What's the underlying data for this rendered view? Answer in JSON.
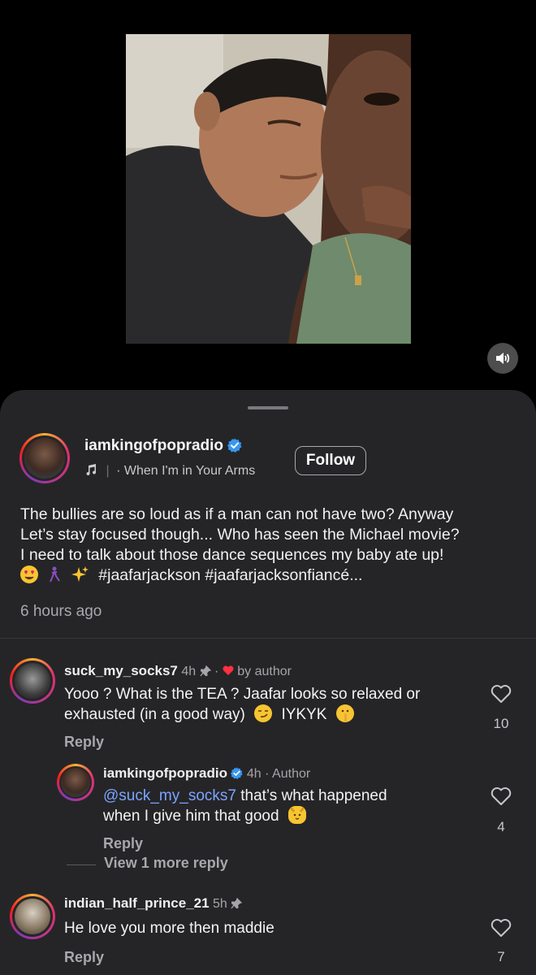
{
  "post": {
    "username": "iamkingofpopradio",
    "music_title": "When I'm in Your Arms",
    "follow_label": "Follow",
    "caption_lines": [
      "The bullies are so loud as if a man can not have two? Anyway",
      "Let’s stay focused though... Who has seen the Michael movie?",
      "I need to talk about those dance sequences my baby ate up!"
    ],
    "caption_tags": "#jaafarjackson #jaafarjacksonfiancé...",
    "time_ago": "6 hours ago"
  },
  "comments": [
    {
      "username": "suck_my_socks7",
      "time": "4h",
      "separator": "·",
      "author_like": "by author",
      "text_line1": "Yooo ? What is the TEA ? Jaafar looks so relaxed or",
      "text_line2_a": "exhausted (in a good way)",
      "text_line2_b": "IYKYK",
      "reply_label": "Reply",
      "likes": "10"
    },
    {
      "username": "iamkingofpopradio",
      "time": "4h",
      "author_badge": "· Author",
      "mention": "@suck_my_socks7",
      "text_line1_rest": " that’s what happened",
      "text_line2": "when I give him that good",
      "reply_label": "Reply",
      "likes": "4",
      "view_more": "View 1 more reply"
    },
    {
      "username": "indian_half_prince_21",
      "time": "5h",
      "text": "He love you more then maddie",
      "reply_label": "Reply",
      "likes": "7"
    }
  ],
  "icons": {
    "music": "music-note-icon",
    "verified": "verified-badge-icon",
    "pin": "pin-icon",
    "heart": "heart-outline-icon",
    "author_heart": "heart-filled-icon",
    "mute": "speaker-icon"
  },
  "colors": {
    "sheet_bg": "#252528",
    "verified_blue": "#3897f0",
    "mention_blue": "#7ca4ff",
    "heart_red": "#ff3040"
  }
}
